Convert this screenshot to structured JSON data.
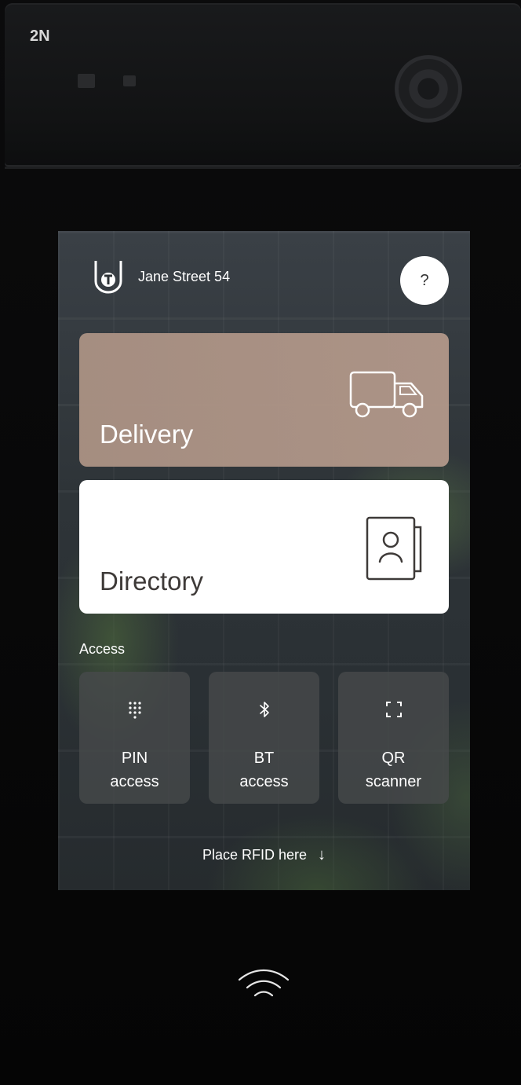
{
  "brand": "2N",
  "screen": {
    "address": "Jane Street 54",
    "help_label": "?",
    "tiles": {
      "delivery": {
        "label": "Delivery",
        "icon": "truck-icon"
      },
      "directory": {
        "label": "Directory",
        "icon": "contact-book-icon"
      }
    },
    "access_section_label": "Access",
    "access": [
      {
        "line1": "PIN",
        "line2": "access",
        "icon": "keypad-icon"
      },
      {
        "line1": "BT",
        "line2": "access",
        "icon": "bluetooth-icon"
      },
      {
        "line1": "QR",
        "line2": "scanner",
        "icon": "qr-scan-icon"
      }
    ],
    "rfid_label": "Place RFID here",
    "rfid_arrow": "↓"
  },
  "colors": {
    "delivery_tile": "#ad9385",
    "directory_tile": "#ffffff",
    "access_card": "#484a4c",
    "device_body": "#0b0b0c"
  }
}
